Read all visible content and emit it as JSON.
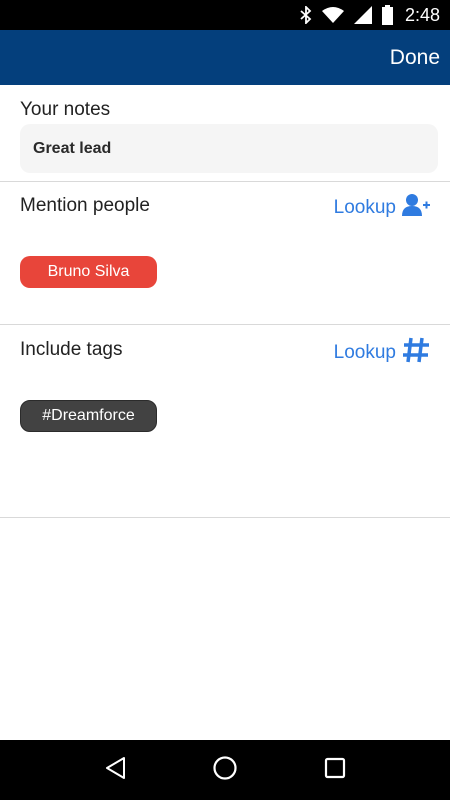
{
  "status_bar": {
    "time": "2:48",
    "icons": [
      "bluetooth-icon",
      "wifi-icon",
      "signal-icon",
      "battery-icon"
    ]
  },
  "app_bar": {
    "done_label": "Done",
    "color": "#043f7c"
  },
  "notes": {
    "label": "Your notes",
    "value": "Great lead"
  },
  "mention": {
    "label": "Mention people",
    "lookup_label": "Lookup",
    "lookup_icon": "add-person-icon",
    "chips": [
      "Bruno Silva"
    ]
  },
  "tags": {
    "label": "Include tags",
    "lookup_label": "Lookup",
    "lookup_icon": "hashtag-icon",
    "chips": [
      "#Dreamforce"
    ]
  },
  "nav_bar": {
    "icons": [
      "back-icon",
      "home-icon",
      "recents-icon"
    ]
  },
  "colors": {
    "accent": "#2f7be0",
    "person_chip": "#e8453a",
    "tag_chip": "#424242"
  }
}
